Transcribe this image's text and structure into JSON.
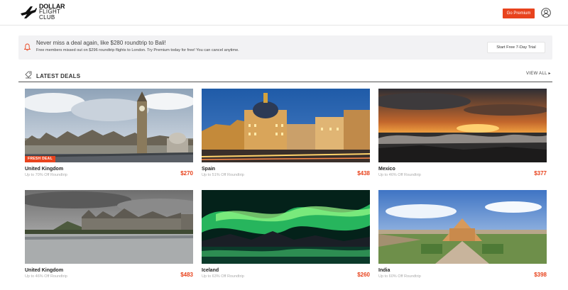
{
  "header": {
    "logo": {
      "line1": "DOLLAR",
      "line2": "FLIGHT",
      "line3": "CLUB"
    },
    "premium_button": "Go Premium"
  },
  "banner": {
    "title": "Never miss a deal again, like $280 roundtrip to Bali!",
    "subtitle": "Free members missed out on $296 roundtrip flights to London. Try Premium today for free! You can cancel anytime.",
    "cta": "Start Free 7-Day Trial"
  },
  "section": {
    "title": "LATEST DEALS",
    "view_all": "VIEW ALL ▸"
  },
  "deals": [
    {
      "name": "United Kingdom",
      "subtitle": "Up to 70% Off Roundtrip",
      "price": "$270",
      "badge": "FRESH DEAL"
    },
    {
      "name": "Spain",
      "subtitle": "Up to 51% Off Roundtrip",
      "price": "$438"
    },
    {
      "name": "Mexico",
      "subtitle": "Up to 46% Off Roundtrip",
      "price": "$377"
    },
    {
      "name": "United Kingdom",
      "subtitle": "Up to 46% Off Roundtrip",
      "price": "$483"
    },
    {
      "name": "Iceland",
      "subtitle": "Up to 63% Off Roundtrip",
      "price": "$260"
    },
    {
      "name": "India",
      "subtitle": "Up to 60% Off Roundtrip",
      "price": "$398"
    }
  ],
  "colors": {
    "accent": "#e8431d",
    "banner_bg": "#f2f2f4"
  }
}
